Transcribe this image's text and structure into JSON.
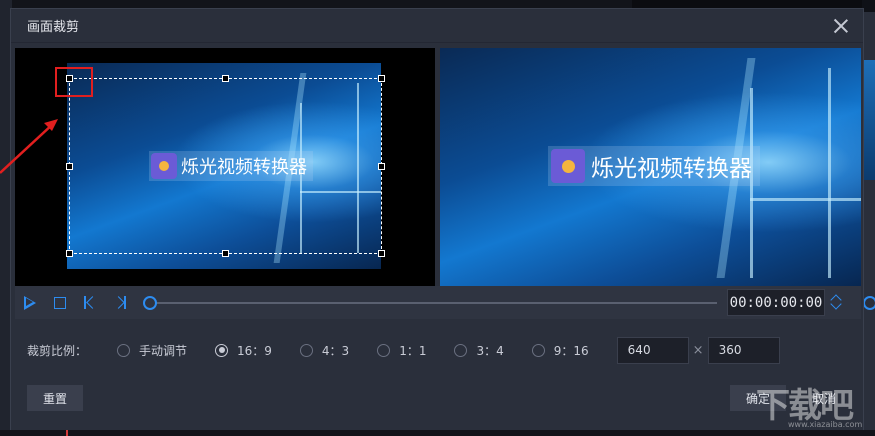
{
  "dialog": {
    "title": "画面裁剪"
  },
  "preview": {
    "logo_text": "烁光视频转换器"
  },
  "playback": {
    "time": "00:00:00:00",
    "progress": 0
  },
  "crop_ratio": {
    "label": "裁剪比例：",
    "options": [
      {
        "label": "手动调节",
        "checked": false
      },
      {
        "label": "16：9",
        "checked": true
      },
      {
        "label": "4：3",
        "checked": false
      },
      {
        "label": "1：1",
        "checked": false
      },
      {
        "label": "3：4",
        "checked": false
      },
      {
        "label": "9：16",
        "checked": false
      }
    ],
    "width": "640",
    "times_sign": "×",
    "height": "360"
  },
  "buttons": {
    "reset": "重置",
    "ok": "确定",
    "cancel": "取消"
  },
  "watermark": {
    "text": "下载吧",
    "sub": "www.xiazaiba.com"
  },
  "colors": {
    "accent": "#2d8cf0",
    "highlight": "#e11f1f"
  }
}
